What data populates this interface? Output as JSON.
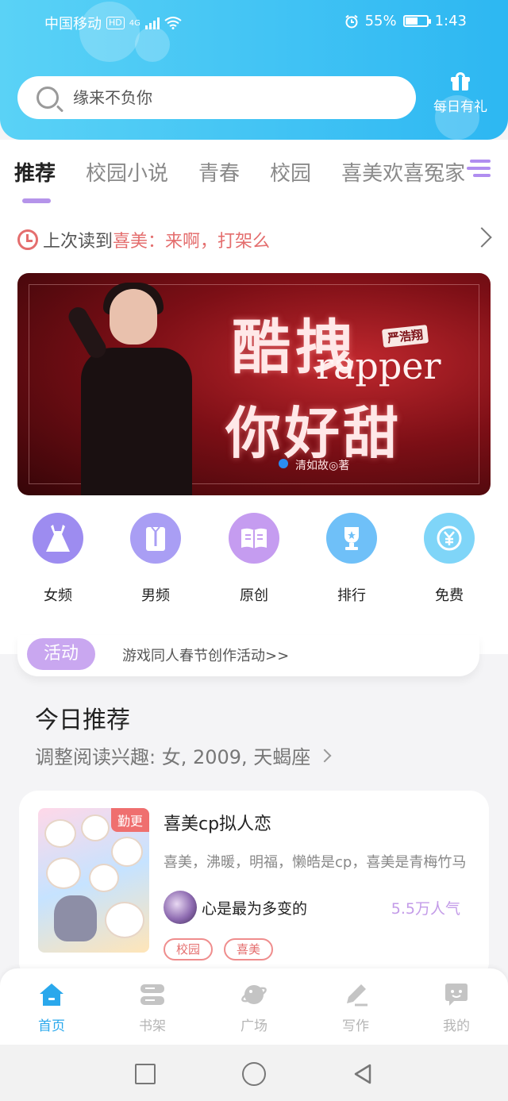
{
  "status_bar": {
    "carrier": "中国移动",
    "hd": "HD",
    "network": "4G",
    "battery_percent": "55%",
    "time": "1:43"
  },
  "search": {
    "placeholder": "缘来不负你"
  },
  "daily_gift": {
    "label": "每日有礼",
    "icon": "gift-icon"
  },
  "tabs": [
    {
      "label": "推荐",
      "active": true
    },
    {
      "label": "校园小说",
      "active": false
    },
    {
      "label": "青春",
      "active": false
    },
    {
      "label": "校园",
      "active": false
    },
    {
      "label": "喜美欢喜冤家",
      "active": false
    }
  ],
  "last_read": {
    "prefix": "上次读到",
    "title": "喜美：来啊，打架么"
  },
  "banner": {
    "title_line1": "酷拽",
    "title_line2": "rapper",
    "title_line3": "你好甜",
    "tag": "严浩翔",
    "author": "清如故◎著"
  },
  "categories": [
    {
      "label": "女频",
      "icon": "dress-icon",
      "color": "#9d8cf0"
    },
    {
      "label": "男频",
      "icon": "shirt-icon",
      "color": "#a99ef4"
    },
    {
      "label": "原创",
      "icon": "book-icon",
      "color": "#c59cf0"
    },
    {
      "label": "排行",
      "icon": "trophy-icon",
      "color": "#6fc0f8"
    },
    {
      "label": "免费",
      "icon": "coin-icon",
      "color": "#7fd5f8"
    }
  ],
  "activity": {
    "badge": "活动",
    "text": "游戏同人春节创作活动>>"
  },
  "today": {
    "title": "今日推荐",
    "interest": "调整阅读兴趣: 女, 2009, 天蝎座"
  },
  "book": {
    "badge": "勤更",
    "title": "喜美cp拟人恋",
    "description": "喜美，沸暖，明福，懒皓是cp，喜美是青梅竹马",
    "author": "心是最为多变的",
    "popularity": "5.5万人气",
    "tags": [
      "校园",
      "喜美"
    ]
  },
  "bottom_nav": [
    {
      "label": "首页",
      "icon": "home-icon",
      "active": true
    },
    {
      "label": "书架",
      "icon": "bookshelf-icon",
      "active": false
    },
    {
      "label": "广场",
      "icon": "planet-icon",
      "active": false
    },
    {
      "label": "写作",
      "icon": "pen-icon",
      "active": false
    },
    {
      "label": "我的",
      "icon": "chat-face-icon",
      "active": false
    }
  ],
  "colors": {
    "header": "#2db7f2",
    "accent_purple": "#b594ea",
    "accent_red": "#e46e6e",
    "nav_active": "#2aa8ec"
  }
}
